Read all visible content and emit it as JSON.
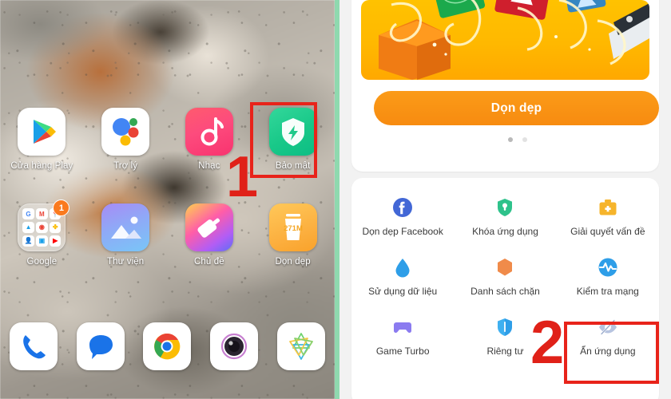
{
  "home_screen": {
    "rows": [
      [
        {
          "label": "Cửa hàng Play",
          "icon": "google-play-icon"
        },
        {
          "label": "Trợ lý",
          "icon": "google-assistant-icon"
        },
        {
          "label": "Nhạc",
          "icon": "music-icon"
        },
        {
          "label": "Bảo mật",
          "icon": "security-shield-icon"
        }
      ],
      [
        {
          "label": "Google",
          "icon": "google-folder-icon",
          "badge": "1"
        },
        {
          "label": "Thư viện",
          "icon": "gallery-icon"
        },
        {
          "label": "Chủ đề",
          "icon": "themes-icon"
        },
        {
          "label": "Dọn dẹp",
          "icon": "cleaner-icon",
          "icon_text": "271M"
        }
      ]
    ],
    "dock": [
      {
        "label": "",
        "icon": "phone-icon"
      },
      {
        "label": "",
        "icon": "messages-icon"
      },
      {
        "label": "",
        "icon": "chrome-icon"
      },
      {
        "label": "",
        "icon": "camera-icon"
      },
      {
        "label": "",
        "icon": "mi-browser-icon"
      }
    ]
  },
  "security_app": {
    "banner": {
      "name": "cleanup-promo-banner"
    },
    "clean_button": "Dọn dẹp",
    "page_dots": {
      "count": 2,
      "active": 0
    },
    "features": [
      {
        "label": "Dọn dẹp Facebook",
        "icon": "facebook-icon",
        "color": "#4267d6"
      },
      {
        "label": "Khóa ứng dụng",
        "icon": "app-lock-shield-icon",
        "color": "#2ec28b"
      },
      {
        "label": "Giải quyết vấn đề",
        "icon": "toolbox-icon",
        "color": "#f6b42b"
      },
      {
        "label": "Sử dụng dữ liệu",
        "icon": "data-drop-icon",
        "color": "#2e9ee8"
      },
      {
        "label": "Danh sách chặn",
        "icon": "blocklist-hexagon-icon",
        "color": "#f08b4a"
      },
      {
        "label": "Kiểm tra mạng",
        "icon": "network-test-icon",
        "color": "#2e9ee8"
      },
      {
        "label": "Game Turbo",
        "icon": "gamepad-icon",
        "color": "#8b7bf0"
      },
      {
        "label": "Riêng tư",
        "icon": "privacy-shield-icon",
        "color": "#2e9ee8"
      },
      {
        "label": "Ẩn ứng dụng",
        "icon": "hidden-apps-eye-icon",
        "color": "#b7c4e0"
      }
    ]
  },
  "annotations": {
    "step1": "1",
    "step2": "2",
    "highlight_color": "#e8231a"
  }
}
